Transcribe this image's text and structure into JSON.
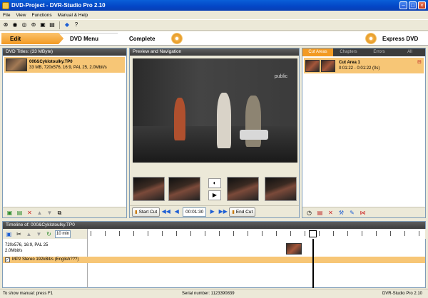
{
  "window": {
    "title": "DVD-Project - DVR-Studio Pro 2.10"
  },
  "menu": [
    "File",
    "View",
    "Functions",
    "Manual & Help"
  ],
  "steps": {
    "edit": "Edit",
    "dvd_menu": "DVD Menu",
    "complete": "Complete",
    "express": "Express DVD"
  },
  "titles_panel": {
    "header": "DVD Titles: (33 MByte)",
    "items": [
      {
        "name": "000&Cyklotoulky.TP0",
        "info": "33 MB, 720x576, 16:9, PAL 25, 2.0Mbit/s"
      }
    ]
  },
  "preview": {
    "header": "Preview and Navigation",
    "watermark": "public",
    "start_cut": "Start Cut",
    "end_cut": "End Cut",
    "time": "00:01:30"
  },
  "cuts_panel": {
    "tabs": [
      "Cut Areas",
      "Chapters",
      "Errors",
      "All"
    ],
    "items": [
      {
        "name": "Cut Area 1",
        "time": "0:01:22 - 0:01:22 (0s)"
      }
    ]
  },
  "timeline": {
    "header": "Timeline of: 000&Cyklotoulky.TP0",
    "zoom": "10 min",
    "info_line1": "720x576, 16:9, PAL 25",
    "info_line2": "2.0Mbit/s",
    "audio_track": "MP2 Stereo 192kBit/s (English???)"
  },
  "status": {
    "left": "To show manual: press F1",
    "serial": "Serial number: 1123390839",
    "right": "DVR-Studio Pro 2.10"
  },
  "colors": {
    "accent": "#f29a23",
    "highlight": "#f7c676",
    "header": "#3c3c3c"
  }
}
